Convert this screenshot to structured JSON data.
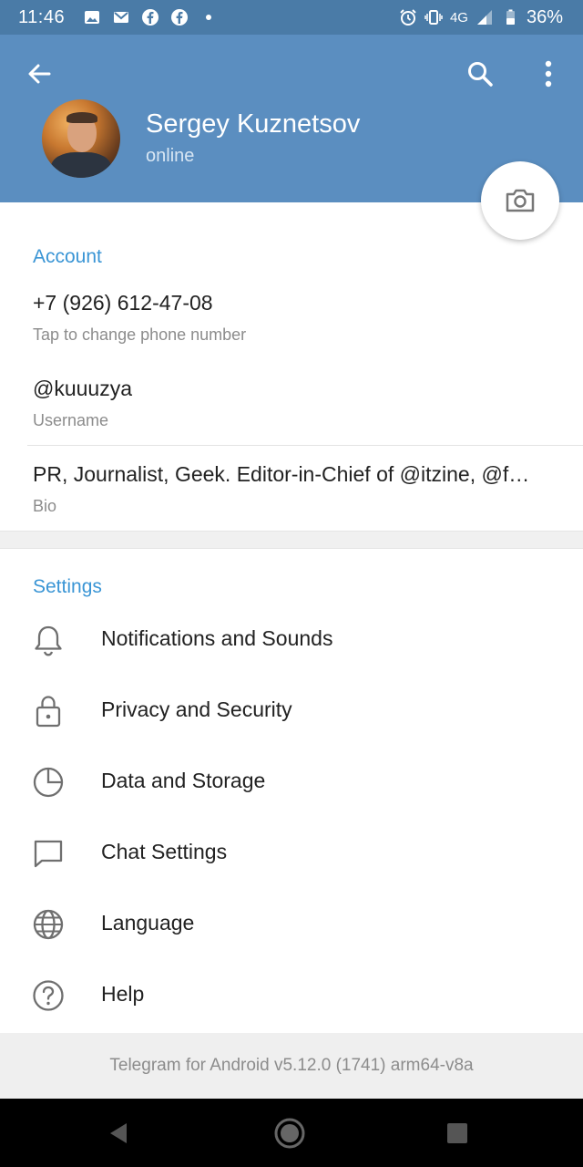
{
  "status_bar": {
    "time": "11:46",
    "network": "4G",
    "battery": "36%",
    "left_icons": [
      "image-icon",
      "gmail-icon",
      "facebook-icon",
      "facebook-icon",
      "dot-icon"
    ],
    "right_icons": [
      "alarm-icon",
      "vibrate-icon",
      "signal-icon",
      "battery-icon"
    ]
  },
  "header": {
    "name": "Sergey Kuznetsov",
    "status": "online",
    "bg_color": "#5b8ec0"
  },
  "account": {
    "section_title": "Account",
    "phone": "+7 (926) 612-47-08",
    "phone_hint": "Tap to change phone number",
    "username": "@kuuuzya",
    "username_label": "Username",
    "bio": "PR, Journalist, Geek. Editor-in-Chief of @itzine, @f…",
    "bio_label": "Bio"
  },
  "settings": {
    "section_title": "Settings",
    "items": [
      {
        "label": "Notifications and Sounds",
        "icon": "bell-icon"
      },
      {
        "label": "Privacy and Security",
        "icon": "lock-icon"
      },
      {
        "label": "Data and Storage",
        "icon": "pie-chart-icon"
      },
      {
        "label": "Chat Settings",
        "icon": "chat-bubble-icon"
      },
      {
        "label": "Language",
        "icon": "globe-icon"
      },
      {
        "label": "Help",
        "icon": "help-icon"
      }
    ]
  },
  "footer": {
    "version": "Telegram for Android v5.12.0 (1741) arm64-v8a"
  },
  "colors": {
    "accent": "#3a95d5",
    "header": "#5b8ec0",
    "status_bar": "#4a7ba7"
  }
}
